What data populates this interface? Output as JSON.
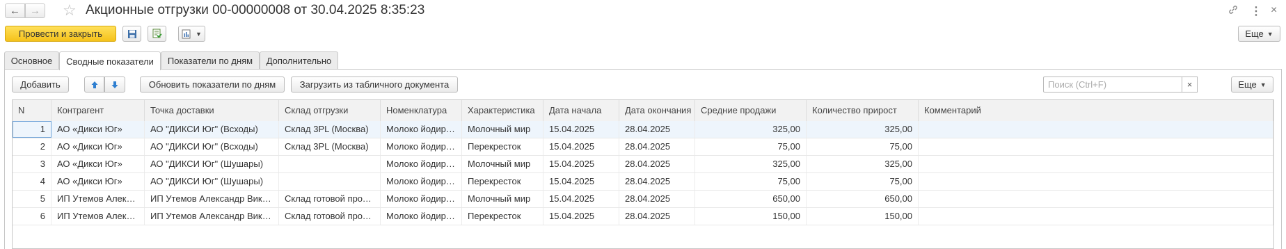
{
  "window": {
    "title": "Акционные отгрузки 00-00000008 от 30.04.2025 8:35:23"
  },
  "toolbar": {
    "post_and_close": "Провести и закрыть",
    "more": "Еще"
  },
  "tabs": [
    {
      "label": "Основное",
      "active": false
    },
    {
      "label": "Сводные показатели",
      "active": true
    },
    {
      "label": "Показатели по дням",
      "active": false
    },
    {
      "label": "Дополнительно",
      "active": false
    }
  ],
  "table_toolbar": {
    "add": "Добавить",
    "update_daily": "Обновить показатели по дням",
    "load_from_sheet": "Загрузить из табличного документа",
    "search_placeholder": "Поиск (Ctrl+F)",
    "clear": "×",
    "more": "Еще"
  },
  "table": {
    "columns": [
      "N",
      "Контрагент",
      "Точка доставки",
      "Склад отгрузки",
      "Номенклатура",
      "Характеристика",
      "Дата начала",
      "Дата окончания",
      "Средние продажи",
      "Количество прирост",
      "Комментарий"
    ],
    "rows": [
      [
        "1",
        "АО «Дикси Юг»",
        "АО \"ДИКСИ Юг\" (Всходы)",
        "Склад 3PL (Москва)",
        "Молоко йодированное",
        "Молочный мир",
        "15.04.2025",
        "28.04.2025",
        "325,00",
        "325,00",
        ""
      ],
      [
        "2",
        "АО «Дикси Юг»",
        "АО \"ДИКСИ Юг\" (Всходы)",
        "Склад 3PL (Москва)",
        "Молоко йодированное",
        "Перекресток",
        "15.04.2025",
        "28.04.2025",
        "75,00",
        "75,00",
        ""
      ],
      [
        "3",
        "АО «Дикси Юг»",
        "АО \"ДИКСИ Юг\" (Шушары)",
        "",
        "Молоко йодированное",
        "Молочный мир",
        "15.04.2025",
        "28.04.2025",
        "325,00",
        "325,00",
        ""
      ],
      [
        "4",
        "АО «Дикси Юг»",
        "АО \"ДИКСИ Юг\" (Шушары)",
        "",
        "Молоко йодированное",
        "Перекресток",
        "15.04.2025",
        "28.04.2025",
        "75,00",
        "75,00",
        ""
      ],
      [
        "5",
        "ИП Утемов Александр Викторович",
        "ИП Утемов Александр Викторович",
        "Склад готовой продукции",
        "Молоко йодированное",
        "Молочный мир",
        "15.04.2025",
        "28.04.2025",
        "650,00",
        "650,00",
        ""
      ],
      [
        "6",
        "ИП Утемов Александр Викторович",
        "ИП Утемов Александр Викторович",
        "Склад готовой продукции",
        "Молоко йодированное",
        "Перекресток",
        "15.04.2025",
        "28.04.2025",
        "150,00",
        "150,00",
        ""
      ]
    ]
  }
}
